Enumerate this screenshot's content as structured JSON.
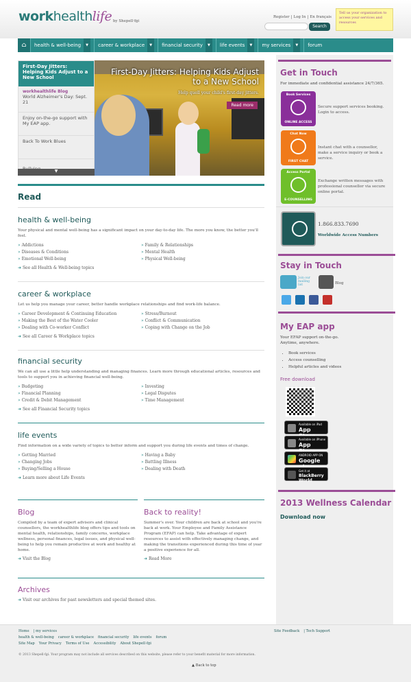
{
  "header": {
    "logo_work": "work",
    "logo_health": "health",
    "logo_life": "life",
    "byline": "by Shepell·fgi",
    "links": [
      "Register",
      "Log In",
      "En français"
    ],
    "search_placeholder": "",
    "search_button": "Search",
    "tell_us": "Tell us your organization to access your services and resources"
  },
  "nav": {
    "items": [
      "health & well-being",
      "career & workplace",
      "financial security",
      "life events",
      "my services",
      "forum"
    ]
  },
  "slider": {
    "selected_tab": "First-Day Jitters: Helping Kids Adjust to a New School",
    "tabs": [
      {
        "kicker": "workhealthlife Blog",
        "label": "World Alzheimer's Day: Sept. 21"
      },
      {
        "kicker": "",
        "label": "Enjoy on-the-go support with My EAP app."
      },
      {
        "kicker": "",
        "label": "Back To Work Blues"
      },
      {
        "kicker": "",
        "label": "Bullying"
      }
    ],
    "caption_title": "First-Day Jitters: Helping Kids Adjust to a New School",
    "caption_sub": "Help quell your child's first-day jitters.",
    "read_more": "Read more"
  },
  "read_heading": "Read",
  "sections": [
    {
      "title": "health & well-being",
      "desc": "Your physical and mental well-being has a significant impact on your day-to-day life. The more you know, the better you'll feel.",
      "left": [
        "Addictions",
        "Diseases & Conditions",
        "Emotional Well-being"
      ],
      "right": [
        "Family & Relationships",
        "Mental Health",
        "Physical Well-being"
      ],
      "see_all": "See all Health & Well-being topics"
    },
    {
      "title": "career & workplace",
      "desc": "Let us help you manage your career, better handle workplace relationships and find work-life balance.",
      "left": [
        "Career Development & Continuing Education",
        "Making the Best of the Water Cooler",
        "Dealing with Co-worker Conflict"
      ],
      "right": [
        "Stress/Burnout",
        "Conflict & Communication",
        "Coping with Change on the Job"
      ],
      "see_all": "See all Career & Workplace topics"
    },
    {
      "title": "financial security",
      "desc": "We can all use a little help understanding and managing finances. Learn more through educational articles, resources and tools to support you in achieving financial well-being.",
      "left": [
        "Budgeting",
        "Financial Planning",
        "Credit & Debit Management"
      ],
      "right": [
        "Investing",
        "Legal Disputes",
        "Time Management"
      ],
      "see_all": "See all Financial Security topics"
    },
    {
      "title": "life events",
      "desc": "Find information on a wide variety of topics to better inform and support you during life events and times of change.",
      "left": [
        "Getting Married",
        "Changing Jobs",
        "Buying/Selling a House"
      ],
      "right": [
        "Having a Baby",
        "Battling Illness",
        "Dealing with Death"
      ],
      "see_all": "Learn more about Life Events"
    }
  ],
  "blog": {
    "title": "Blog",
    "desc": "Compiled by a team of expert advisors and clinical counsellors, the workhealthlife blog offers tips and tools on mental health, relationships, family concerns, workplace wellness, personal finances, legal issues, and physical well-being to help you remain productive at work and healthy at home.",
    "link": "Visit the Blog"
  },
  "reality": {
    "title": "Back to reality!",
    "desc": "Summer's over. Your children are back at school and you're back at work. Your Employee and Family Assistance Program (EFAP) can help. Take advantage of expert resources to assist with effectively managing change, and making the transitions experienced during this time of year a positive experience for all.",
    "link": "Read More"
  },
  "archives": {
    "title": "Archives",
    "link": "Visit our archives for past newsletters and special themed sites."
  },
  "sidebar": {
    "get_in_touch": "Get in Touch",
    "gt_desc": "For immediate and confidential assistance 24/7/365.",
    "tiles": [
      {
        "top": "Book Services",
        "cap": "ONLINE ACCESS",
        "desc": "Secure support services booking. Login to access.",
        "color": "#8a2f9a"
      },
      {
        "top": "Chat Now",
        "cap": "FIRST CHAT",
        "desc": "Instant chat with a counsellor, make a service inquiry or book a service.",
        "color": "#f07a1a"
      },
      {
        "top": "Access Portal",
        "cap": "E-COUNSELLING",
        "desc": "Exchange written messages with professional counsellor via secure online portal.",
        "color": "#6fbf2a"
      }
    ],
    "phone": "1.866.833.7690",
    "phone_label": "Worldwide Access Numbers",
    "stay_in_touch": "Stay in Touch",
    "mailing": "Join our mailing list",
    "blog": "Blog",
    "eap_title": "My EAP app",
    "eap_desc": "Your EFAP support on-the-go. Anytime, anywhere.",
    "eap_items": [
      "Book services",
      "Access counselling",
      "Helpful articles and videos"
    ],
    "free_download": "Free download",
    "stores": [
      {
        "s1": "Available on iPad",
        "s2": "App Store"
      },
      {
        "s1": "Available on iPhone",
        "s2": "App Store"
      },
      {
        "s1": "ANDROID APP ON",
        "s2": "Google play"
      },
      {
        "s1": "Get it at",
        "s2": "BlackBerry World"
      }
    ],
    "wellness": "2013 Wellness Calendar",
    "download_now": "Download now"
  },
  "footer": {
    "row1": [
      "Home",
      "my services"
    ],
    "row2": [
      "health & well-being",
      "career & workplace",
      "financial security",
      "life events",
      "forum"
    ],
    "row3": [
      "Site Map",
      "Your Privacy",
      "Terms of Use",
      "Accessibility",
      "About Shepell·fgi"
    ],
    "right": [
      "Site Feedback",
      "Tech Support"
    ],
    "copyright": "© 2013 Shepell·fgi. Your program may not include all services described on this website, please refer to your benefit material for more information.",
    "back_to_top": "Back to top"
  }
}
